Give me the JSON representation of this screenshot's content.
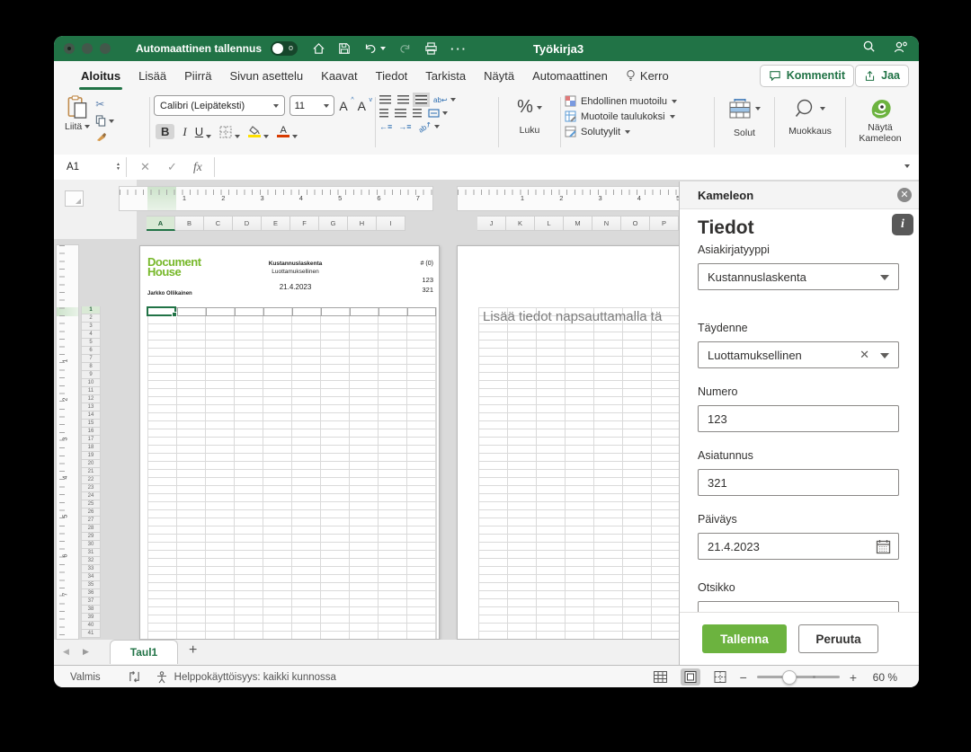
{
  "colors": {
    "title_green": "#217346",
    "accent_green": "#6cb33f",
    "logo_green": "#77b82a"
  },
  "titlebar": {
    "autosave_label": "Automaattinen tallennus",
    "toggle_state": "o",
    "title": "Työkirja3"
  },
  "tabs": [
    "Aloitus",
    "Lisää",
    "Piirrä",
    "Sivun asettelu",
    "Kaavat",
    "Tiedot",
    "Tarkista",
    "Näytä",
    "Automaattinen",
    "Kerro"
  ],
  "tabbar_buttons": {
    "comments": "Kommentit",
    "share": "Jaa"
  },
  "ribbon": {
    "paste_label": "Liitä",
    "font_name": "Calibri (Leipäteksti)",
    "font_size": "11",
    "bold": "B",
    "italic": "I",
    "underline": "U",
    "number_label": "Luku",
    "percent": "%",
    "styles": [
      "Ehdollinen muotoilu",
      "Muotoile taulukoksi",
      "Solutyylit"
    ],
    "cells_label": "Solut",
    "editing_label": "Muokkaus",
    "kameleon_label_line1": "Näytä",
    "kameleon_label_line2": "Kameleon"
  },
  "formula_bar": {
    "cell_ref": "A1",
    "fx_label": "fx"
  },
  "sheet": {
    "ruler_numbers": [
      "1",
      "2",
      "3",
      "4",
      "5",
      "6",
      "7"
    ],
    "columns_page1": [
      "A",
      "B",
      "C",
      "D",
      "E",
      "F",
      "G",
      "H",
      "I"
    ],
    "columns_page2": [
      "J",
      "K",
      "L",
      "M",
      "N",
      "O",
      "P"
    ],
    "rows": [
      "1",
      "2",
      "3",
      "4",
      "5",
      "6",
      "7",
      "8",
      "9",
      "10",
      "11",
      "12",
      "13",
      "14",
      "15",
      "16",
      "17",
      "18",
      "19",
      "20",
      "21",
      "22",
      "23",
      "24",
      "25",
      "26",
      "27",
      "28",
      "29",
      "30",
      "31",
      "32",
      "33",
      "34",
      "35",
      "36",
      "37",
      "38",
      "39",
      "40",
      "41"
    ]
  },
  "document": {
    "logo_line1": "Document",
    "logo_line2": "House",
    "type": "Kustannuslaskenta",
    "classification": "Luottamuksellinen",
    "date": "21.4.2023",
    "number_field": "# (0)",
    "number": "123",
    "case_id": "321",
    "author": "Jarkko Ollikainen",
    "page2_hint": "Lisää tiedot napsauttamalla tä"
  },
  "panel": {
    "title": "Kameleon",
    "heading": "Tiedot",
    "info_label": "i",
    "fields": [
      {
        "label": "Asiakirjatyyppi",
        "value": "Kustannuslaskenta"
      },
      {
        "label": "Täydenne",
        "value": "Luottamuksellinen"
      },
      {
        "label": "Numero",
        "value": "123"
      },
      {
        "label": "Asiatunnus",
        "value": "321"
      },
      {
        "label": "Päiväys",
        "value": "21.4.2023"
      },
      {
        "label": "Otsikko",
        "value": ""
      }
    ],
    "save_label": "Tallenna",
    "cancel_label": "Peruuta"
  },
  "sheet_tabs": {
    "active_tab": "Taul1",
    "add_label": "+"
  },
  "status_bar": {
    "ready": "Valmis",
    "accessibility": "Helppokäyttöisyys: kaikki kunnossa",
    "zoom_level": "60 %"
  }
}
